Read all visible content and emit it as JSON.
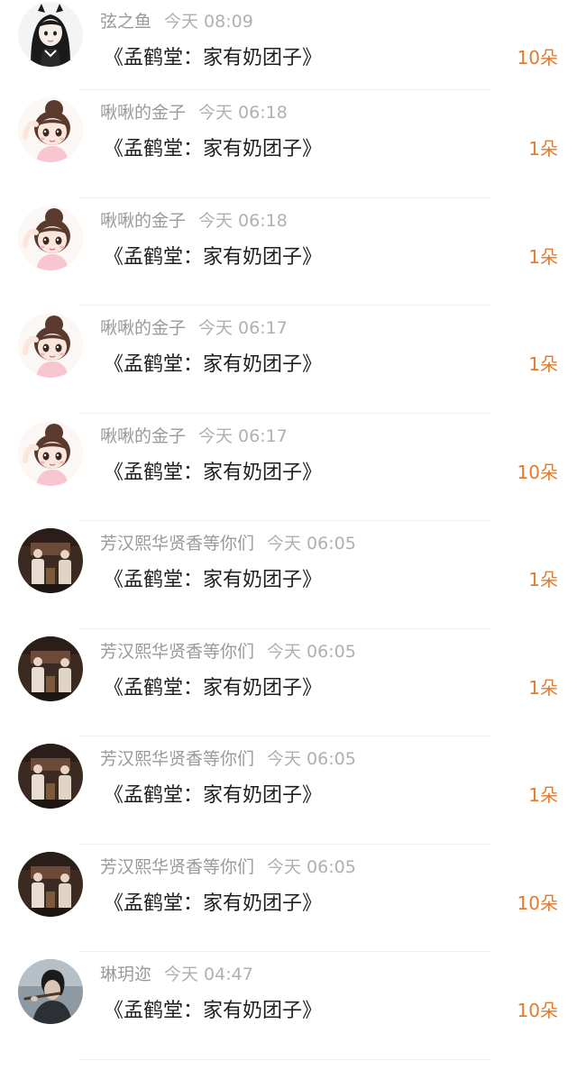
{
  "items": [
    {
      "user": "弦之鱼",
      "time": "今天 08:09",
      "title": "《孟鹤堂：家有奶团子》",
      "count": "10朵",
      "avatar": "girl-bw-avatar"
    },
    {
      "user": "啾啾的金子",
      "time": "今天 06:18",
      "title": "《孟鹤堂：家有奶团子》",
      "count": "1朵",
      "avatar": "cartoon-girl-avatar"
    },
    {
      "user": "啾啾的金子",
      "time": "今天 06:18",
      "title": "《孟鹤堂：家有奶团子》",
      "count": "1朵",
      "avatar": "cartoon-girl-avatar"
    },
    {
      "user": "啾啾的金子",
      "time": "今天 06:17",
      "title": "《孟鹤堂：家有奶团子》",
      "count": "1朵",
      "avatar": "cartoon-girl-avatar"
    },
    {
      "user": "啾啾的金子",
      "time": "今天 06:17",
      "title": "《孟鹤堂：家有奶团子》",
      "count": "10朵",
      "avatar": "cartoon-girl-avatar"
    },
    {
      "user": "芳汉熙华贤香等你们",
      "time": "今天 06:05",
      "title": "《孟鹤堂：家有奶团子》",
      "count": "1朵",
      "avatar": "stage-performers-avatar"
    },
    {
      "user": "芳汉熙华贤香等你们",
      "time": "今天 06:05",
      "title": "《孟鹤堂：家有奶团子》",
      "count": "1朵",
      "avatar": "stage-performers-avatar"
    },
    {
      "user": "芳汉熙华贤香等你们",
      "time": "今天 06:05",
      "title": "《孟鹤堂：家有奶团子》",
      "count": "1朵",
      "avatar": "stage-performers-avatar"
    },
    {
      "user": "芳汉熙华贤香等你们",
      "time": "今天 06:05",
      "title": "《孟鹤堂：家有奶团子》",
      "count": "10朵",
      "avatar": "stage-performers-avatar"
    },
    {
      "user": "琳玥迩",
      "time": "今天 04:47",
      "title": "《孟鹤堂：家有奶团子》",
      "count": "10朵",
      "avatar": "man-flute-avatar"
    }
  ],
  "colors": {
    "username": "#9a9a9a",
    "time": "#b0b0b0",
    "title": "#1f1f1f",
    "count": "#e37a2e",
    "divider": "#f0f0f0"
  }
}
